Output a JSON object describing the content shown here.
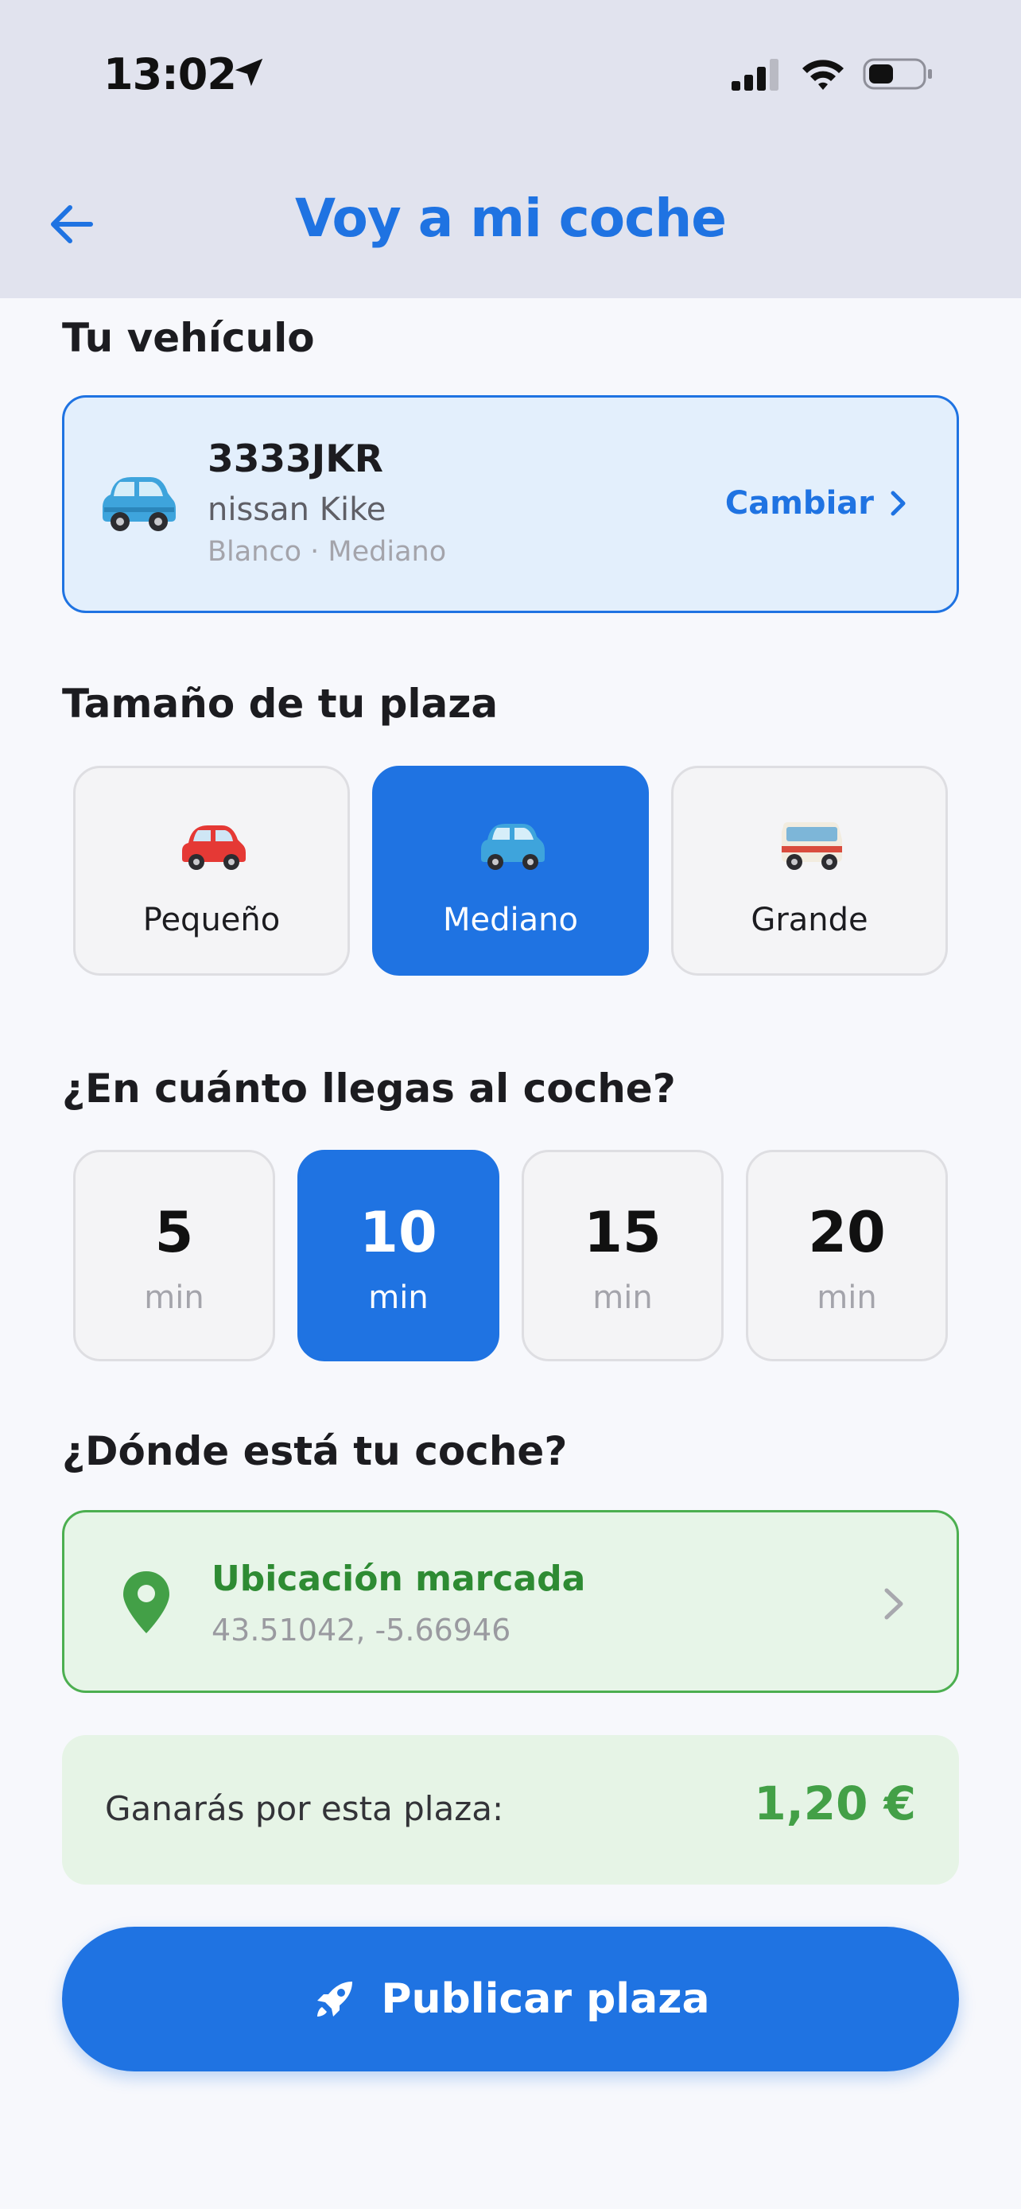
{
  "status_bar": {
    "time": "13:02"
  },
  "header": {
    "title": "Voy a mi coche"
  },
  "vehicle": {
    "section_title": "Tu vehículo",
    "plate": "3333JKR",
    "model": "nissan Kike",
    "specs": "Blanco · Mediano",
    "change_label": "Cambiar"
  },
  "size": {
    "section_title": "Tamaño de tu plaza",
    "options": [
      {
        "label": "Pequeño",
        "selected": false
      },
      {
        "label": "Mediano",
        "selected": true
      },
      {
        "label": "Grande",
        "selected": false
      }
    ]
  },
  "arrival": {
    "section_title": "¿En cuánto llegas al coche?",
    "options": [
      {
        "value": "5",
        "unit": "min",
        "selected": false
      },
      {
        "value": "10",
        "unit": "min",
        "selected": true
      },
      {
        "value": "15",
        "unit": "min",
        "selected": false
      },
      {
        "value": "20",
        "unit": "min",
        "selected": false
      }
    ]
  },
  "location": {
    "section_title": "¿Dónde está tu coche?",
    "title": "Ubicación marcada",
    "coords": "43.51042, -5.66946"
  },
  "earnings": {
    "label": "Ganarás por esta plaza:",
    "value": "1,20 €"
  },
  "publish": {
    "label": "Publicar plaza"
  },
  "colors": {
    "accent": "#1f73e2",
    "success": "#43a047",
    "header_bg": "#e1e3ee"
  },
  "icons": [
    "location-arrow-icon",
    "signal-icon",
    "wifi-icon",
    "battery-icon",
    "back-arrow-icon",
    "car-icon",
    "chevron-right-icon",
    "map-pin-icon",
    "rocket-icon"
  ]
}
